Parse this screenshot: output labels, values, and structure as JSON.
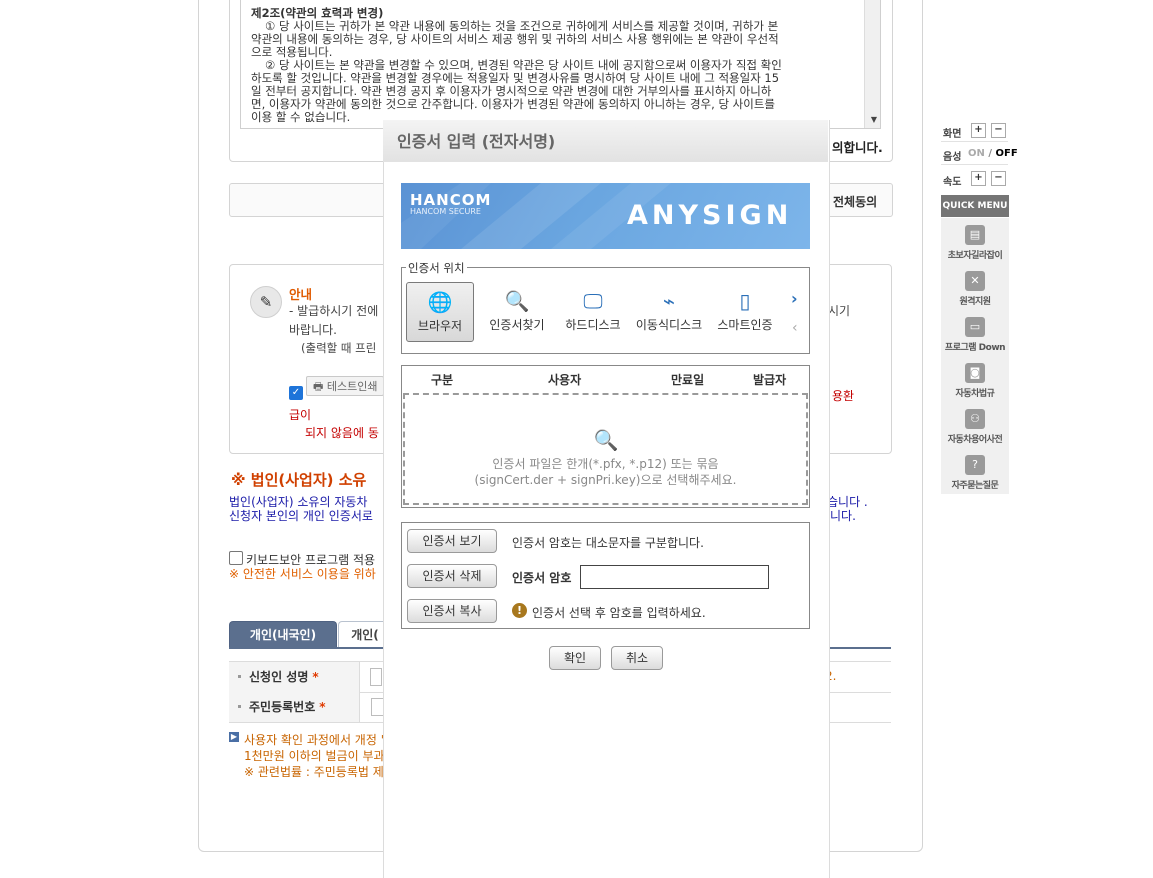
{
  "terms": {
    "heading": "제2조(약관의 효력과 변경)",
    "para1_l1": "① 당 사이트는 귀하가 본 약관 내용에 동의하는 것을 조건으로 귀하에게 서비스를 제공할 것이며, 귀하가 본",
    "para1_l2": "약관의 내용에 동의하는 경우, 당 사이트의 서비스 제공 행위 및 귀하의 서비스 사용 행위에는 본 약관이 우선적",
    "para1_l3": "으로 적용됩니다.",
    "para2_l1": "② 당 사이트는 본 약관을 변경할 수 있으며, 변경된 약관은 당 사이트 내에 공지함으로써 이용자가 직접 확인",
    "para2_l2": "하도록 할 것입니다. 약관을 변경할 경우에는 적용일자 및 변경사유를 명시하여 당 사이트 내에 그 적용일자 15",
    "para2_l3": "일 전부터 공지합니다. 약관 변경 공지 후 이용자가 명시적으로 약관 변경에 대한 거부의사를 표시하지 아니하",
    "para2_l4": "면, 이용자가 약관에 동의한 것으로 간주합니다. 이용자가 변경된 약관에 동의하지 아니하는 경우, 당 사이트를",
    "para2_l5": "이용 할 수 없습니다.",
    "agree_text": "의합니다.",
    "all_agree": "전체동의"
  },
  "notice": {
    "title": "안내",
    "line1": "- 발급하시기 전에",
    "line1_tail": "시기",
    "line2": "바랍니다.",
    "line3": "(출력할 때 프린",
    "test_print": "테스트인쇄",
    "tail_red": "용환",
    "red1": "급이",
    "red2": "되지 않음에 동"
  },
  "corp": {
    "title": "※ 법인(사업자) 소유",
    "line1": "법인(사업자) 소유의 자동차",
    "line1_tail": "습니다 .",
    "line2": "신청자 본인의 개인 인증서로",
    "line2_tail": "니다."
  },
  "keyboard": {
    "label": "키보드보안 프로그램 적용",
    "notice": "※ 안전한 서비스 이용을 위하"
  },
  "tabs": [
    "개인(내국인)",
    "개인("
  ],
  "form": {
    "name_label": "신청인 성명",
    "name_hint_tail": "2.",
    "rrn_label": "주민등록번호",
    "rrn_sep": "-",
    "required": "*"
  },
  "warning": {
    "line1": "사용자 확인 과정에서 개정 \"주민등록법\"에 의해 타인의 주민등록번호를 부정사용하는 자는 3년 이하의 징역 또는",
    "line2": "1천만원 이하의 벌금이 부과될 수 있습니다.",
    "line3": "※ 관련법률 : 주민등록법 제37조(벌칙) 제8호 (시행일 2013.03.23)"
  },
  "submit_label": "확인",
  "quick": {
    "screen": "화면",
    "sound": "음성",
    "sound_on": "ON",
    "sound_sep": "/",
    "sound_off": "OFF",
    "speed": "속도",
    "plus": "+",
    "minus": "−",
    "menu_title": "QUICK MENU",
    "items": [
      "초보자길라잡이",
      "원격지원",
      "프로그램 Down",
      "자동차법규",
      "자동차용어사전",
      "자주묻는질문"
    ]
  },
  "dialog": {
    "title": "인증서 입력 (전자서명)",
    "brand": "HANCOM",
    "brand_sub": "HANCOM SECURE",
    "product": "ANYSIGN",
    "location_legend": "인증서 위치",
    "locations": [
      "브라우저",
      "인증서찾기",
      "하드디스크",
      "이동식디스크",
      "스마트인증"
    ],
    "next_arrow": "›",
    "prev_arrow": "‹",
    "columns": [
      "구분",
      "사용자",
      "만료일",
      "발급자"
    ],
    "drop_line1": "인증서 파일은 한개(*.pfx, *.p12) 또는 묶음",
    "drop_line2": "(signCert.der + signPri.key)으로 선택해주세요.",
    "view_cert": "인증서 보기",
    "delete_cert": "인증서 삭제",
    "copy_cert": "인증서 복사",
    "case_note": "인증서 암호는 대소문자를 구분합니다.",
    "password_label": "인증서 암호",
    "select_note": "인증서 선택 후 암호를 입력하세요.",
    "ok": "확인",
    "cancel": "취소"
  },
  "colors": {
    "accent_orange": "#d04000",
    "tab_active": "#5b6f8e",
    "banner_blue": "#6aa6e0",
    "warning_text": "#c86400"
  }
}
